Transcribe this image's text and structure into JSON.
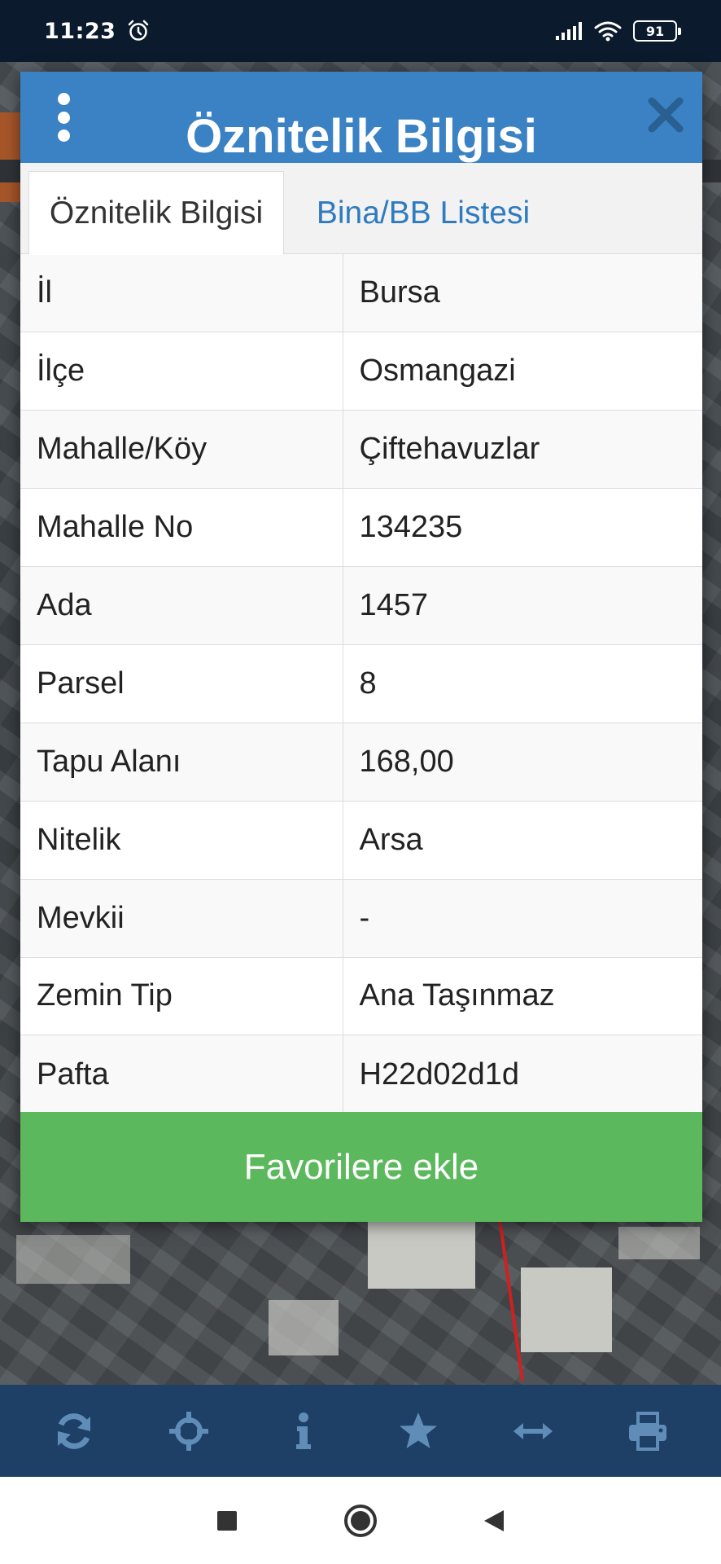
{
  "status_bar": {
    "time": "11:23",
    "battery": "91"
  },
  "dialog": {
    "title": "Öznitelik Bilgisi",
    "tabs": [
      {
        "label": "Öznitelik Bilgisi",
        "active": true
      },
      {
        "label": "Bina/BB Listesi",
        "active": false
      }
    ],
    "rows": [
      {
        "key": "İl",
        "value": "Bursa"
      },
      {
        "key": "İlçe",
        "value": "Osmangazi"
      },
      {
        "key": "Mahalle/Köy",
        "value": "Çiftehavuzlar"
      },
      {
        "key": "Mahalle No",
        "value": "134235"
      },
      {
        "key": "Ada",
        "value": "1457"
      },
      {
        "key": "Parsel",
        "value": "8"
      },
      {
        "key": "Tapu Alanı",
        "value": "168,00"
      },
      {
        "key": "Nitelik",
        "value": "Arsa"
      },
      {
        "key": "Mevkii",
        "value": "-"
      },
      {
        "key": "Zemin Tip",
        "value": "Ana Taşınmaz"
      },
      {
        "key": "Pafta",
        "value": "H22d02d1d"
      }
    ],
    "favorite_button": "Favorilere ekle"
  },
  "toolbar": {
    "icons": [
      "refresh-icon",
      "crosshair-icon",
      "info-icon",
      "star-icon",
      "measure-arrows-icon",
      "print-icon"
    ]
  },
  "colors": {
    "header": "#3a82c4",
    "tab_link": "#2e7bbf",
    "favorite_button": "#5cb85c",
    "toolbar": "#1e3f66",
    "toolbar_icon": "#5f8db8",
    "status_bar": "#0b1a2c"
  }
}
